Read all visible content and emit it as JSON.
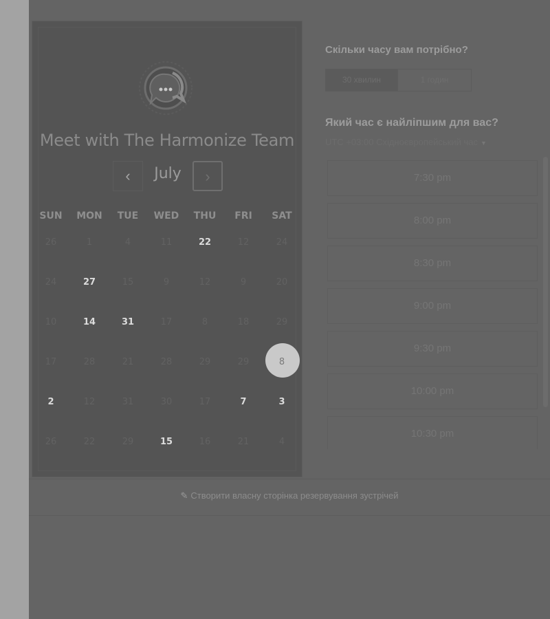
{
  "calendar": {
    "title": "Meet with The Harmonize Team",
    "month": "July",
    "prev_icon": "‹",
    "next_icon": "›",
    "weekdays": [
      "SUN",
      "MON",
      "TUE",
      "WED",
      "THU",
      "FRI",
      "SAT"
    ],
    "weeks": [
      [
        "26",
        "1",
        "4",
        "11",
        "22",
        "12",
        "24"
      ],
      [
        "24",
        "27",
        "15",
        "9",
        "12",
        "9",
        "20"
      ],
      [
        "10",
        "14",
        "31",
        "17",
        "8",
        "18",
        "29"
      ],
      [
        "17",
        "28",
        "21",
        "28",
        "29",
        "29",
        "8"
      ],
      [
        "2",
        "12",
        "31",
        "30",
        "17",
        "7",
        "3"
      ],
      [
        "26",
        "22",
        "29",
        "15",
        "16",
        "21",
        "4"
      ]
    ],
    "available_days": [
      "22",
      "27",
      "14",
      "31",
      "2",
      "7",
      "3",
      "15"
    ],
    "selected_day": "8"
  },
  "booking": {
    "duration_question": "Скільки часу вам потрібно?",
    "durations": [
      "30 хвилин",
      "1 годин"
    ],
    "selected_duration": "30 хвилин",
    "time_question": "Який час є найліпшим для вас?",
    "timezone": "UTC +03:00 Східноєвропейський час",
    "time_slots": [
      "7:30 pm",
      "8:00 pm",
      "8:30 pm",
      "9:00 pm",
      "9:30 pm",
      "10:00 pm",
      "10:30 pm"
    ]
  },
  "footer": {
    "link_text": "Створити власну сторінка резервування зустрічей"
  },
  "colors": {
    "overlay_bg": "#646464",
    "left_strip": "#a3a3a3",
    "panel_bg": "#545454",
    "selected_circle": "#c9c9c9"
  },
  "icons": {
    "logo": "chat-bubble-logo-icon",
    "timezone_caret": "caret-down-icon",
    "footer": "tools-icon"
  }
}
